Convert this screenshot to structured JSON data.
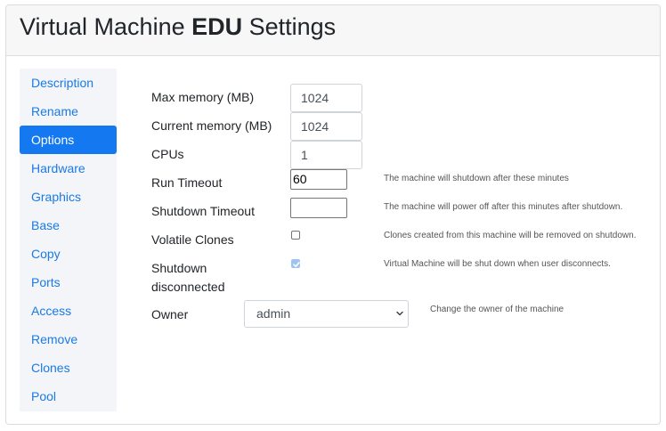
{
  "header": {
    "title_prefix": "Virtual Machine ",
    "title_name": "EDU",
    "title_suffix": " Settings"
  },
  "sidebar": {
    "items": [
      {
        "label": "Description"
      },
      {
        "label": "Rename"
      },
      {
        "label": "Options",
        "active": true
      },
      {
        "label": "Hardware"
      },
      {
        "label": "Graphics"
      },
      {
        "label": "Base"
      },
      {
        "label": "Copy"
      },
      {
        "label": "Ports"
      },
      {
        "label": "Access"
      },
      {
        "label": "Remove"
      },
      {
        "label": "Clones"
      },
      {
        "label": "Pool"
      }
    ]
  },
  "form": {
    "max_memory": {
      "label": "Max memory (MB)",
      "value": "1024"
    },
    "current_memory": {
      "label": "Current memory (MB)",
      "value": "1024"
    },
    "cpus": {
      "label": "CPUs",
      "value": "1"
    },
    "run_timeout": {
      "label": "Run Timeout",
      "value": "60",
      "help": "The machine will shutdown after these minutes"
    },
    "shutdown_timeout": {
      "label": "Shutdown Timeout",
      "value": "",
      "help": "The machine will power off after this minutes after shutdown."
    },
    "volatile_clones": {
      "label": "Volatile Clones",
      "checked": false,
      "help": "Clones created from this machine will be removed on shutdown."
    },
    "shutdown_disconnected": {
      "label_line1": "Shutdown",
      "label_line2": "disconnected",
      "checked": true,
      "help": "Virtual Machine will be shut down when user disconnects."
    },
    "owner": {
      "label": "Owner",
      "selected": "admin",
      "help": "Change the owner of the machine"
    }
  },
  "icons": {
    "checkbox_check": "check-icon",
    "select_arrow": "chevron-down-icon"
  },
  "colors": {
    "accent": "#1479f0",
    "link": "#1a7ae6",
    "sidebar_bg": "#f3f5f8",
    "header_bg": "#f7f7f7"
  }
}
